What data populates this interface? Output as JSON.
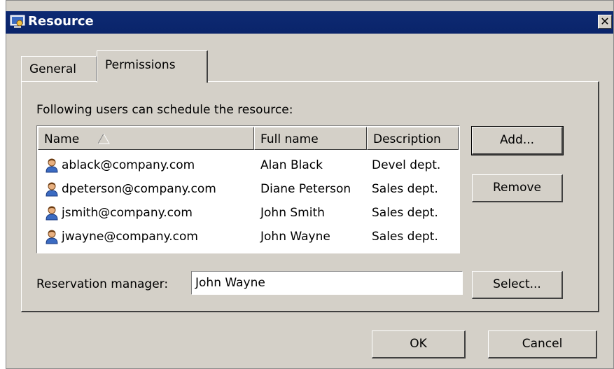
{
  "window": {
    "title": "Resource",
    "close_glyph": "✕"
  },
  "tabs": [
    {
      "label": "General",
      "active": false
    },
    {
      "label": "Permissions",
      "active": true
    }
  ],
  "permissions": {
    "users_label": "Following users can schedule the resource:",
    "columns": {
      "name": "Name",
      "full_name": "Full name",
      "description": "Description"
    },
    "sort_indicator": "sort-ascending-icon",
    "rows": [
      {
        "name": "ablack@company.com",
        "full_name": "Alan Black",
        "description": "Devel dept."
      },
      {
        "name": "dpeterson@company.com",
        "full_name": "Diane Peterson",
        "description": "Sales dept."
      },
      {
        "name": "jsmith@company.com",
        "full_name": "John Smith",
        "description": "Sales dept."
      },
      {
        "name": "jwayne@company.com",
        "full_name": "John Wayne",
        "description": "Sales dept."
      }
    ],
    "add_label": "Add...",
    "remove_label": "Remove",
    "manager_label": "Reservation manager:",
    "manager_value": "John Wayne",
    "select_label": "Select..."
  },
  "footer": {
    "ok_label": "OK",
    "cancel_label": "Cancel"
  },
  "colors": {
    "titlebar": "#0a246a",
    "face": "#d4d0c8"
  }
}
